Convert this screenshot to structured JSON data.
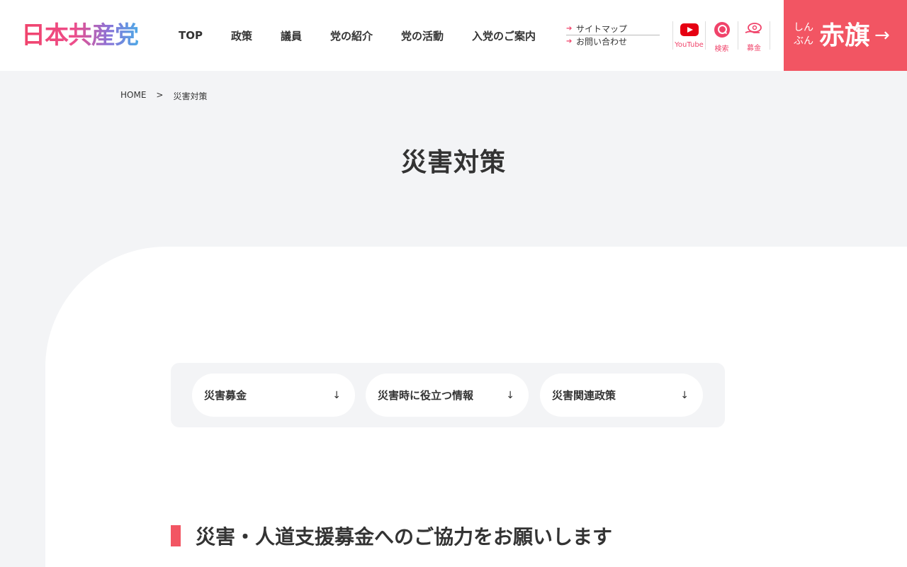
{
  "header": {
    "logo": "日本共産党",
    "nav": [
      "TOP",
      "政策",
      "議員",
      "党の紹介",
      "党の活動",
      "入党のご案内"
    ],
    "subnav": [
      "サイトマップ",
      "お問い合わせ"
    ],
    "icons": [
      {
        "label": "YouTube",
        "icon": "youtube-icon"
      },
      {
        "label": "検索",
        "icon": "search-icon"
      },
      {
        "label": "募金",
        "icon": "donation-icon"
      }
    ],
    "akahata": {
      "small": "しんぶん",
      "big": "赤旗",
      "arrow": "→"
    },
    "colors": {
      "accent": "#f25563",
      "logo_gradient": [
        "#f0436a",
        "#8a73d8",
        "#4ea8e6"
      ]
    }
  },
  "breadcrumb": {
    "home": "HOME",
    "sep": ">",
    "current": "災害対策"
  },
  "page": {
    "title": "災害対策"
  },
  "anchors": [
    {
      "label": "災害募金",
      "icon": "arrow-down-icon"
    },
    {
      "label": "災害時に役立つ情報",
      "icon": "arrow-down-icon"
    },
    {
      "label": "災害関連政策",
      "icon": "arrow-down-icon"
    }
  ],
  "section": {
    "title": "災害・人道支援募金へのご協力をお願いします"
  }
}
